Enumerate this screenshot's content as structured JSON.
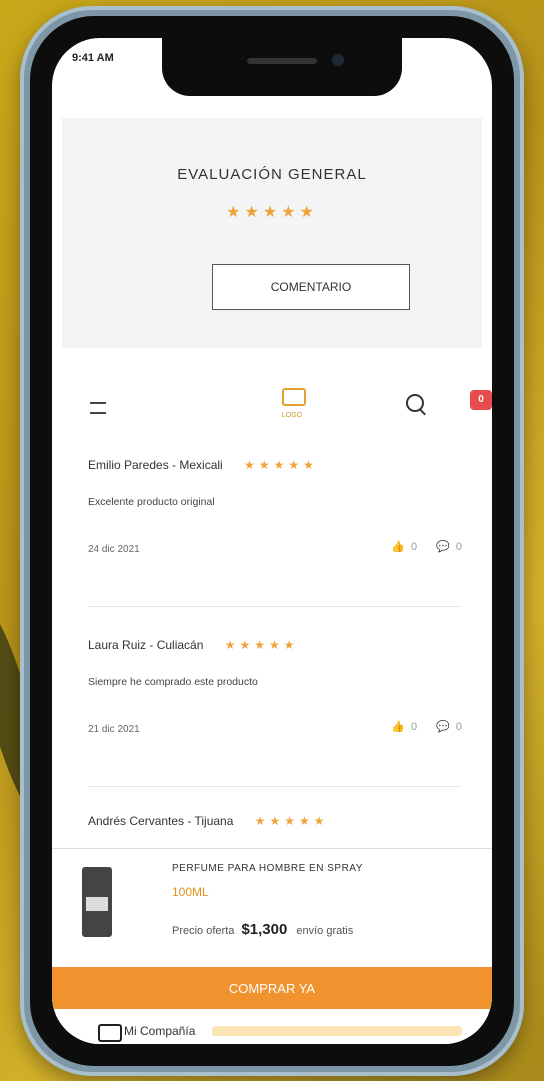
{
  "status_bar": {
    "time": "9:41 AM"
  },
  "overall_rating": {
    "title": "EVALUACIÓN GENERAL",
    "stars": "★★★★★",
    "comment_button": "COMENTARIO"
  },
  "header": {
    "logo_text": "LOGO",
    "cart_count": "0"
  },
  "reviews": [
    {
      "name": "Emilio Paredes - Mexicali",
      "stars": "★★★★★",
      "text": "Excelente producto original",
      "date": "24 dic 2021",
      "likes": "0",
      "dislikes": "0"
    },
    {
      "name": "Laura Ruiz - Culiacán",
      "stars": "★★★★★",
      "text": "Siempre he comprado este producto",
      "date": "21 dic 2021",
      "likes": "0",
      "dislikes": "0"
    },
    {
      "name": "Andrés Cervantes - Tijuana",
      "stars": "★★★★★"
    }
  ],
  "purchase_bar": {
    "title": "PERFUME PARA HOMBRE EN SPRAY",
    "variant": "100ML",
    "price_label": "Precio oferta",
    "price": "$1,300",
    "price_note": "envío gratis"
  },
  "buy_button": "COMPRAR YA",
  "footer": {
    "text": "Mi Compañía"
  },
  "colors": {
    "accent": "#f0922e",
    "stars": "#f0a33a",
    "badge": "#e84b4b"
  },
  "icons": [
    "menu-icon",
    "search-icon",
    "cart-icon",
    "thumb-up-icon",
    "comment-icon",
    "truck-icon"
  ]
}
